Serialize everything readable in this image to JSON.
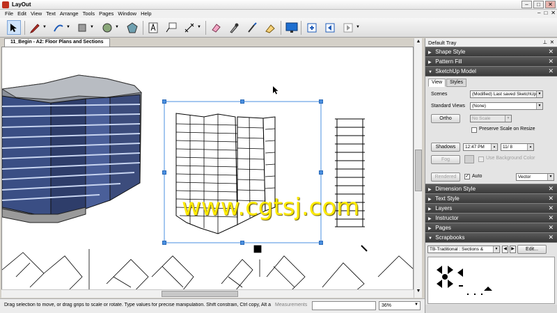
{
  "window": {
    "title": "LayOut",
    "minimize": "–",
    "maximize": "□",
    "close": "✕"
  },
  "menu": {
    "items": [
      "File",
      "Edit",
      "View",
      "Text",
      "Arrange",
      "Tools",
      "Pages",
      "Window",
      "Help"
    ],
    "doc_controls": [
      "–",
      "□",
      "✕"
    ]
  },
  "toolbar": {
    "tools": [
      "select-tool",
      "pencil-tool",
      "arc-tool",
      "rectangle-tool",
      "circle-tool",
      "polygon-tool",
      "text-tool",
      "label-tool",
      "dimension-tool",
      "eraser-tool",
      "eyedropper-tool",
      "split-tool",
      "join-tool",
      "presentation-tool",
      "add-page-tool",
      "previous-page-tool",
      "next-page-tool"
    ]
  },
  "document": {
    "tab_title": "11_Begin - A2: Floor Plans and Sections"
  },
  "watermark": "www.cgtsj.com",
  "status": {
    "hint": "Drag selection to move, or drag grips to scale or rotate. Type values for precise manipulation. Shift constrain, Ctrl copy, Alt a…",
    "measurements_label": "Measurements",
    "measurements_value": "",
    "zoom": "36%"
  },
  "tray": {
    "title": "Default Tray",
    "pin": "⊥",
    "close": "✕",
    "panels_top": [
      {
        "label": "Shape Style",
        "expanded": false
      },
      {
        "label": "Pattern Fill",
        "expanded": false
      },
      {
        "label": "SketchUp Model",
        "expanded": true
      }
    ],
    "sketchup": {
      "tabs": [
        "View",
        "Styles"
      ],
      "scenes_label": "Scenes",
      "scenes_value": "(Modified) Last saved SketchUp",
      "standard_views_label": "Standard Views",
      "standard_views_value": "(None)",
      "ortho": "Ortho",
      "scale_value": "No Scale",
      "preserve_scale": "Preserve Scale on Resize",
      "shadows": "Shadows",
      "time": "12:47 PM",
      "date": "11/ 8",
      "fog": "Fog",
      "use_background": "Use Background Color",
      "rendered": "Rendered",
      "auto": "Auto",
      "auto_checked": true,
      "vector": "Vector"
    },
    "panels_bottom": [
      {
        "label": "Dimension Style",
        "expanded": false
      },
      {
        "label": "Text Style",
        "expanded": false
      },
      {
        "label": "Layers",
        "expanded": false
      },
      {
        "label": "Instructor",
        "expanded": false
      },
      {
        "label": "Pages",
        "expanded": false
      },
      {
        "label": "Scrapbooks",
        "expanded": true
      }
    ],
    "scrapbooks": {
      "value": "TB-Traditional : Sections &",
      "edit": "Edit..."
    }
  }
}
